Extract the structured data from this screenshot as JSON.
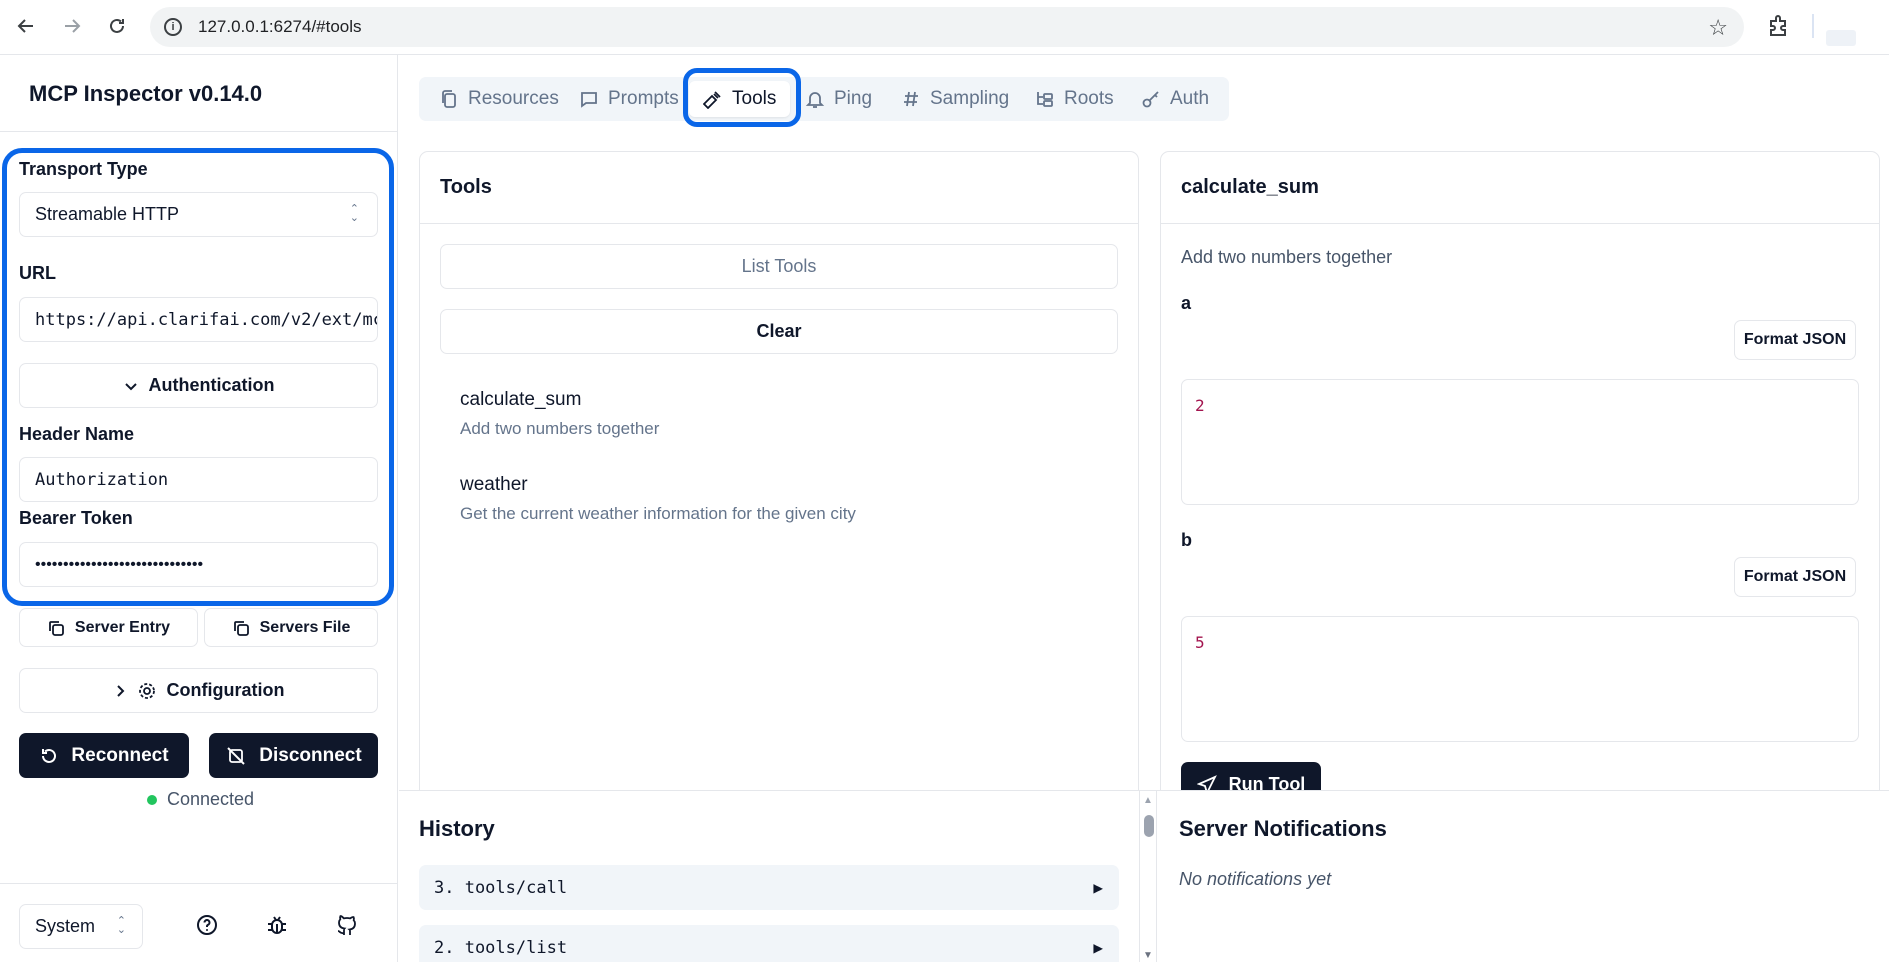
{
  "browser": {
    "url": "127.0.0.1:6274/#tools"
  },
  "sidebar": {
    "app_title": "MCP Inspector v0.14.0",
    "transport_label": "Transport Type",
    "transport_value": "Streamable HTTP",
    "url_label": "URL",
    "url_value": "https://api.clarifai.com/v2/ext/mc",
    "auth_toggle_label": "Authentication",
    "header_name_label": "Header Name",
    "header_name_value": "Authorization",
    "bearer_token_label": "Bearer Token",
    "bearer_token_value": "••••••••••••••••••••••••••••••",
    "server_entry_label": "Server Entry",
    "servers_file_label": "Servers File",
    "configuration_label": "Configuration",
    "reconnect_label": "Reconnect",
    "disconnect_label": "Disconnect",
    "status_text": "Connected",
    "status_color": "#22c55e",
    "theme_value": "System"
  },
  "tabs": [
    {
      "label": "Resources",
      "icon": "files-icon"
    },
    {
      "label": "Prompts",
      "icon": "message-square-icon"
    },
    {
      "label": "Tools",
      "icon": "hammer-icon",
      "active": true
    },
    {
      "label": "Ping",
      "icon": "bell-icon"
    },
    {
      "label": "Sampling",
      "icon": "hash-icon"
    },
    {
      "label": "Roots",
      "icon": "folder-tree-icon"
    },
    {
      "label": "Auth",
      "icon": "key-icon"
    }
  ],
  "tools_panel": {
    "title": "Tools",
    "list_tools_label": "List Tools",
    "clear_label": "Clear",
    "items": [
      {
        "name": "calculate_sum",
        "description": "Add two numbers together"
      },
      {
        "name": "weather",
        "description": "Get the current weather information for the given city"
      }
    ]
  },
  "tool_detail": {
    "title": "calculate_sum",
    "description": "Add two numbers together",
    "params": [
      {
        "name": "a",
        "value": "2",
        "format_label": "Format JSON"
      },
      {
        "name": "b",
        "value": "5",
        "format_label": "Format JSON"
      }
    ],
    "run_label": "Run Tool"
  },
  "history": {
    "title": "History",
    "rows": [
      {
        "label": "3. tools/call"
      },
      {
        "label": "2. tools/list"
      }
    ]
  },
  "notifications": {
    "title": "Server Notifications",
    "empty_text": "No notifications yet"
  },
  "colors": {
    "accent_highlight": "#0a66e8",
    "dark_button": "#0f172a"
  }
}
